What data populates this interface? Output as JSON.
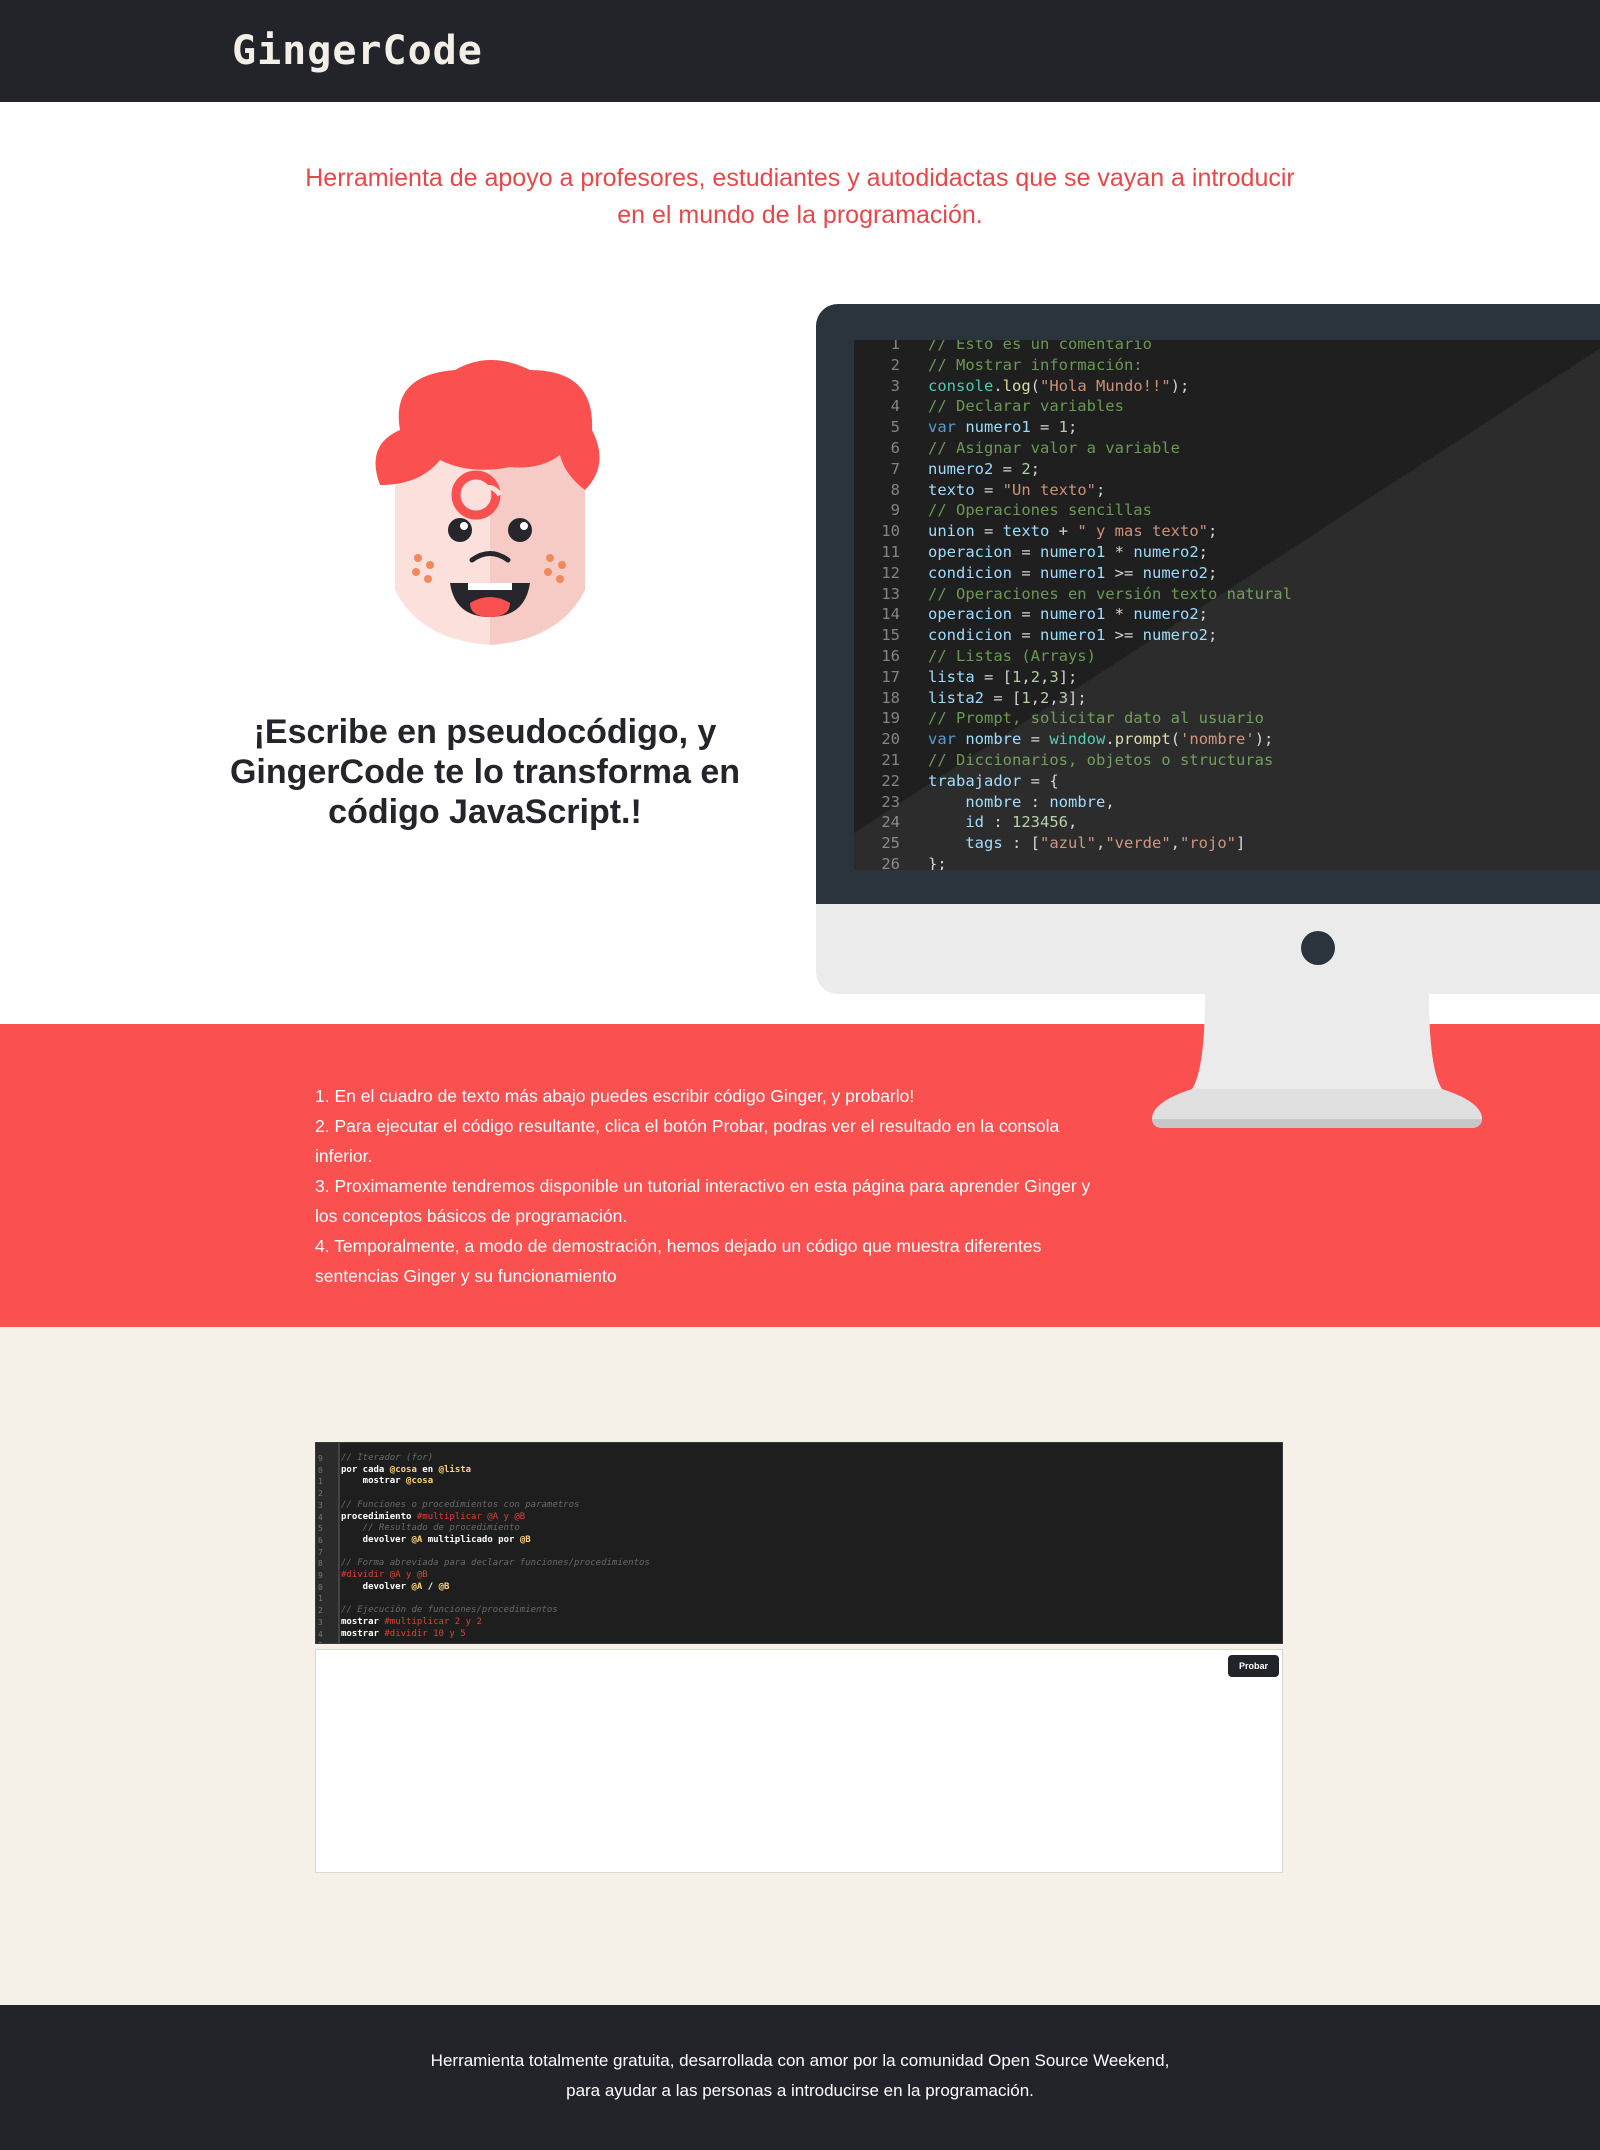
{
  "header": {
    "logo": "GingerCode"
  },
  "tagline": "Herramienta de apoyo a profesores, estudiantes y autodidactas que se vayan a introducir en el mundo de la programación.",
  "hero": {
    "headline": "¡Escribe en pseudocódigo, y GingerCode te lo transforma en código JavaScript.!",
    "code_lines": [
      "// Esto es un comentario",
      "// Mostrar información:",
      "console.log(\"Hola Mundo!!\");",
      "// Declarar variables",
      "var numero1 = 1;",
      "// Asignar valor a variable",
      "numero2 = 2;",
      "texto = \"Un texto\";",
      "// Operaciones sencillas",
      "union = texto + \" y mas texto\";",
      "operacion = numero1 * numero2;",
      "condicion = numero1 >= numero2;",
      "// Operaciones en versión texto natural",
      "operacion = numero1 * numero2;",
      "condicion = numero1 >= numero2;",
      "// Listas (Arrays)",
      "lista = [1,2,3];",
      "lista2 = [1,2,3];",
      "// Prompt, solicitar dato al usuario",
      "var nombre = window.prompt('nombre');",
      "// Diccionarios, objetos o structuras",
      "trabajador = {",
      "    nombre : nombre,",
      "    id : 123456,",
      "    tags : [\"azul\",\"verde\",\"rojo\"]",
      "};"
    ]
  },
  "instructions": [
    "1. En el cuadro de texto más abajo puedes escribir código Ginger, y probarlo!",
    "2. Para ejecutar el código resultante, clica el botón Probar, podras ver el resultado en la consola inferior.",
    "3. Proximamente tendremos disponible un tutorial interactivo en esta página para aprender Ginger y los conceptos básicos de programación.",
    "4. Temporalmente, a modo de demostración, hemos dejado un código que muestra diferentes sentencias Ginger y su funcionamiento"
  ],
  "editor": {
    "line_numbers": [
      "9",
      "0",
      "1",
      "2",
      "3",
      "4",
      "5",
      "6",
      "7",
      "8",
      "9",
      "0",
      "1",
      "2",
      "3",
      "4",
      "5",
      "6"
    ],
    "lines": [
      "// Iterador (for)",
      "por cada @cosa en @lista",
      "    mostrar @cosa",
      "",
      "// Funciones o procedimientos con parametros",
      "procedimiento #multiplicar @A y @B",
      "    // Resultado de procedimiento",
      "    devolver @A multiplicado por @B",
      "",
      "// Forma abreviada para declarar funciones/procedimientos",
      "#dividir @A y @B",
      "    devolver @A / @B",
      "",
      "// Ejecución de funciones/procedimientos",
      "mostrar #multiplicar 2 y 2",
      "mostrar #dividir 10 y 5"
    ]
  },
  "console": {
    "run_button": "Probar"
  },
  "footer": {
    "line1": "Herramienta totalmente gratuita, desarrollada con amor por la comunidad Open Source Weekend,",
    "line2": "para ayudar a las personas a introducirse en la programación."
  },
  "colors": {
    "accent": "#fb5050",
    "dark": "#23232a",
    "beige": "#f5f0e8",
    "tagline": "#e8474a"
  }
}
